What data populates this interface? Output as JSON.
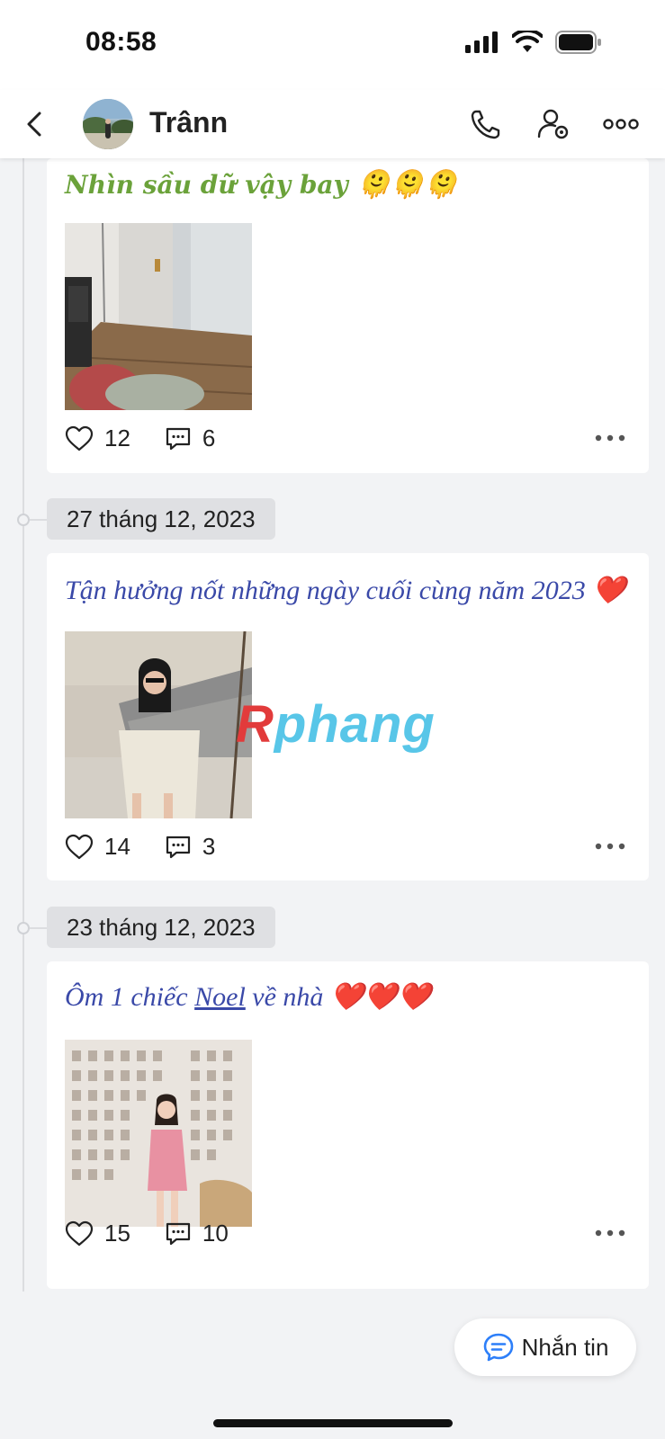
{
  "status_bar": {
    "time": "08:58"
  },
  "header": {
    "contact_name": "Trânn"
  },
  "posts": [
    {
      "date": "",
      "caption": "Nhìn sầu dữ vậy bay",
      "caption_emoji": "🫠🫠🫠",
      "photo_desc": "room",
      "likes": "12",
      "comments": "6"
    },
    {
      "date": "27 tháng 12, 2023",
      "caption": "Tận hưởng nốt những ngày cuối cùng năm 2023",
      "caption_emoji": "❤️",
      "photo_desc": "beach",
      "likes": "14",
      "comments": "3"
    },
    {
      "date": "23 tháng 12, 2023",
      "caption_prefix": "Ôm 1 chiếc",
      "caption_link": "Noel",
      "caption_suffix": "về nhà",
      "caption_emoji": "❤️❤️❤️",
      "photo_desc": "gallery",
      "likes": "15",
      "comments": "10"
    }
  ],
  "watermark": {
    "part1": "R",
    "part2": "phang"
  },
  "fab": {
    "label": "Nhắn tin"
  },
  "colors": {
    "accent_blue": "#2d7ff9",
    "caption_blue": "#3a49a8",
    "caption_green": "#6ba23a"
  }
}
